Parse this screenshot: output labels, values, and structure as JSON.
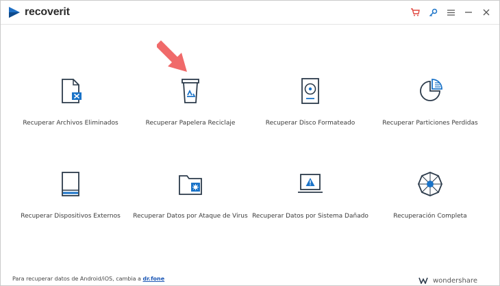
{
  "app": {
    "name": "recoverit",
    "colors": {
      "accent": "#1a73c8",
      "cart": "#e0463f",
      "key": "#1a73c8",
      "arrow": "#f06a6a"
    }
  },
  "titlebar": {
    "icons": [
      "cart-icon",
      "key-icon",
      "menu-icon",
      "minimize-icon",
      "close-icon"
    ]
  },
  "options": [
    {
      "label": "Recuperar Archivos Eliminados",
      "icon": "deleted-file-icon"
    },
    {
      "label": "Recuperar Papelera Reciclaje",
      "icon": "recycle-bin-icon"
    },
    {
      "label": "Recuperar Disco Formateado",
      "icon": "hard-disk-icon"
    },
    {
      "label": "Recuperar Particiones Perdidas",
      "icon": "partition-icon"
    },
    {
      "label": "Recuperar Dispositivos Externos",
      "icon": "external-device-icon"
    },
    {
      "label": "Recuperar Datos por Ataque de Virus",
      "icon": "virus-folder-icon"
    },
    {
      "label": "Recuperar Datos por Sistema Dañado",
      "icon": "crashed-system-icon"
    },
    {
      "label": "Recuperación Completa",
      "icon": "complete-recovery-icon"
    }
  ],
  "footer": {
    "text": "Para recuperar datos de Android/iOS, cambia a ",
    "link": "dr.fone"
  },
  "brand": {
    "text": "wondershare"
  }
}
